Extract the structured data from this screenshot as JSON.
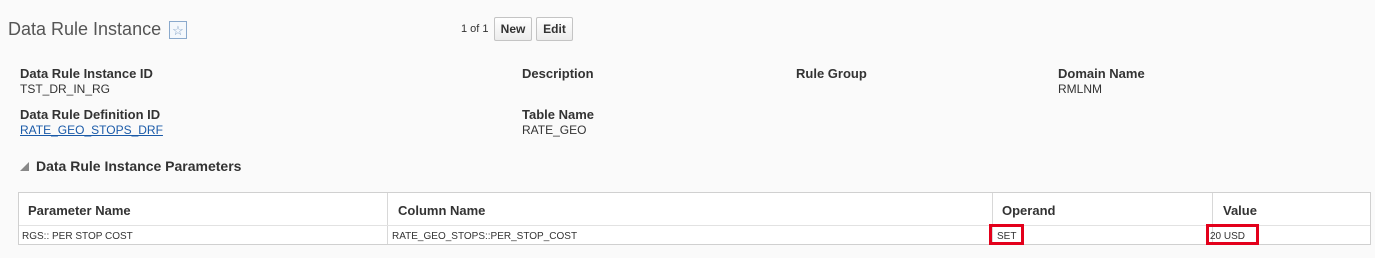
{
  "page": {
    "title": "Data Rule Instance",
    "favorite_icon": "star-icon"
  },
  "pager": {
    "text": "1 of 1",
    "new_label": "New",
    "edit_label": "Edit"
  },
  "details": {
    "instance_id": {
      "label": "Data Rule Instance ID",
      "value": "TST_DR_IN_RG"
    },
    "definition_id": {
      "label": "Data Rule Definition ID",
      "value": "RATE_GEO_STOPS_DRF"
    },
    "description": {
      "label": "Description",
      "value": ""
    },
    "table_name": {
      "label": "Table Name",
      "value": "RATE_GEO"
    },
    "rule_group": {
      "label": "Rule Group",
      "value": ""
    },
    "domain_name": {
      "label": "Domain Name",
      "value": "RMLNM"
    }
  },
  "parameters": {
    "section_title": "Data Rule Instance Parameters",
    "columns": [
      "Parameter Name",
      "Column Name",
      "Operand",
      "Value"
    ],
    "rows": [
      [
        "RGS:: PER STOP COST",
        "RATE_GEO_STOPS::PER_STOP_COST",
        "SET",
        "20 USD"
      ]
    ],
    "highlight_color": "#e3001b"
  }
}
